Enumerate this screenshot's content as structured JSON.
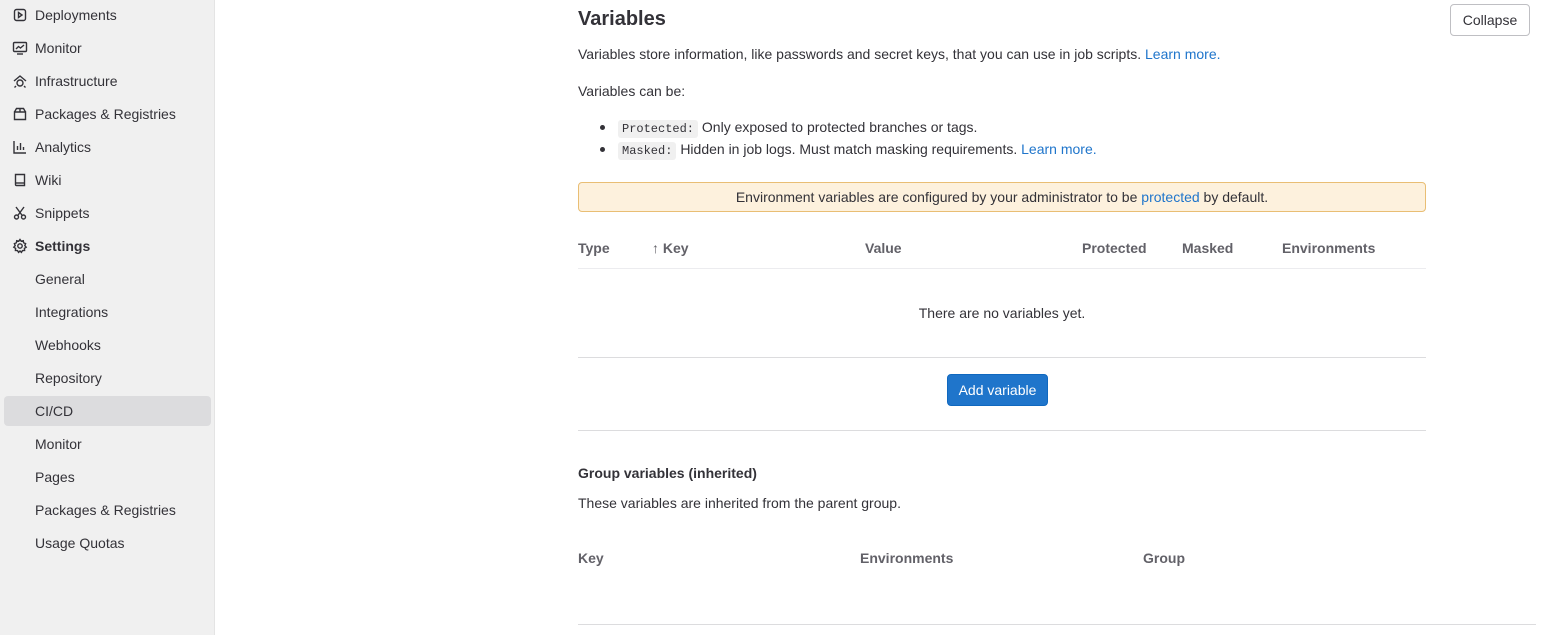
{
  "sidebar": {
    "items": [
      {
        "label": "Deployments",
        "icon": "deployments-icon"
      },
      {
        "label": "Monitor",
        "icon": "monitor-icon"
      },
      {
        "label": "Infrastructure",
        "icon": "infrastructure-icon"
      },
      {
        "label": "Packages & Registries",
        "icon": "package-icon"
      },
      {
        "label": "Analytics",
        "icon": "chart-icon"
      },
      {
        "label": "Wiki",
        "icon": "book-icon"
      },
      {
        "label": "Snippets",
        "icon": "scissors-icon"
      },
      {
        "label": "Settings",
        "icon": "gear-icon"
      }
    ],
    "settings_subitems": [
      {
        "label": "General"
      },
      {
        "label": "Integrations"
      },
      {
        "label": "Webhooks"
      },
      {
        "label": "Repository"
      },
      {
        "label": "CI/CD",
        "active": true
      },
      {
        "label": "Monitor"
      },
      {
        "label": "Pages"
      },
      {
        "label": "Packages & Registries"
      },
      {
        "label": "Usage Quotas"
      }
    ]
  },
  "variables": {
    "title": "Variables",
    "collapse_label": "Collapse",
    "description": "Variables store information, like passwords and secret keys, that you can use in job scripts.",
    "learn_more": "Learn more.",
    "can_be": "Variables can be:",
    "protected_chip": "Protected:",
    "protected_text": "Only exposed to protected branches or tags.",
    "masked_chip": "Masked:",
    "masked_text": "Hidden in job logs. Must match masking requirements.",
    "masked_learn_more": "Learn more.",
    "alert_prefix": "Environment variables are configured by your administrator to be",
    "alert_link": "protected",
    "alert_suffix": "by default.",
    "table_headers": {
      "type": "Type",
      "sort_arrow": "↑",
      "key": "Key",
      "value": "Value",
      "protected": "Protected",
      "masked": "Masked",
      "environments": "Environments"
    },
    "empty_text": "There are no variables yet.",
    "add_button": "Add variable"
  },
  "group_variables": {
    "title": "Group variables (inherited)",
    "description": "These variables are inherited from the parent group.",
    "headers": {
      "key": "Key",
      "environments": "Environments",
      "group": "Group"
    }
  },
  "colors": {
    "link": "#1f75cb",
    "primary_button": "#1f75cb",
    "alert_background": "#fdf1dd",
    "sidebar_background": "#f0f0f0"
  }
}
